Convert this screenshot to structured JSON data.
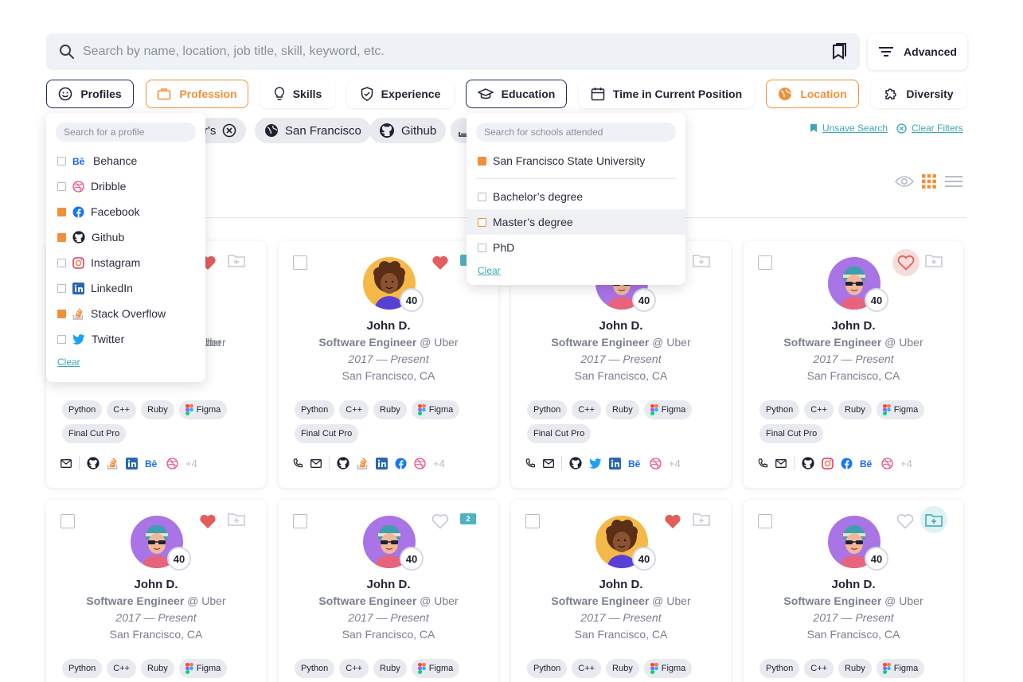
{
  "search": {
    "placeholder": "Search by name, location, job title, skill, keyword, etc.",
    "advanced_label": "Advanced"
  },
  "filters": [
    "Profiles",
    "Profession",
    "Skills",
    "Experience",
    "Education",
    "Time in Current Position",
    "Location",
    "Diversity"
  ],
  "chips": {
    "partial_label": "r's",
    "location": "San Francisco",
    "github": "Github"
  },
  "links": {
    "unsave": "Unsave Search",
    "clear_filters": "Clear Filters"
  },
  "profiles_dropdown": {
    "placeholder": "Search for a profile",
    "items": [
      "Behance",
      "Dribble",
      "Facebook",
      "Github",
      "Instagram",
      "LinkedIn",
      "Stack Overflow",
      "Twitter"
    ],
    "clear": "Clear"
  },
  "education_dropdown": {
    "placeholder": "Search for schools attended",
    "selected": "San Francisco State University",
    "items": [
      "Bachelor’s degree",
      "Master’s degree",
      "PhD"
    ],
    "clear": "Clear"
  },
  "candidate": {
    "name": "John D.",
    "role": "Software Engineer",
    "company": "@ Uber",
    "dates": "2017  —  Present",
    "location": "San Francisco, CA",
    "score": "40",
    "tags": [
      "Python",
      "C++",
      "Ruby",
      "Figma",
      "Final Cut Pro"
    ],
    "more": "+4"
  },
  "partial_text": "ber",
  "folder_count": "2",
  "colors": {
    "accent": "#f0913a",
    "teal": "#3ba6b4",
    "navy": "#1f2d5a",
    "heart": "#e35d5d",
    "avatar_purple": "#a974e6",
    "avatar_yellow": "#f5b94a"
  }
}
